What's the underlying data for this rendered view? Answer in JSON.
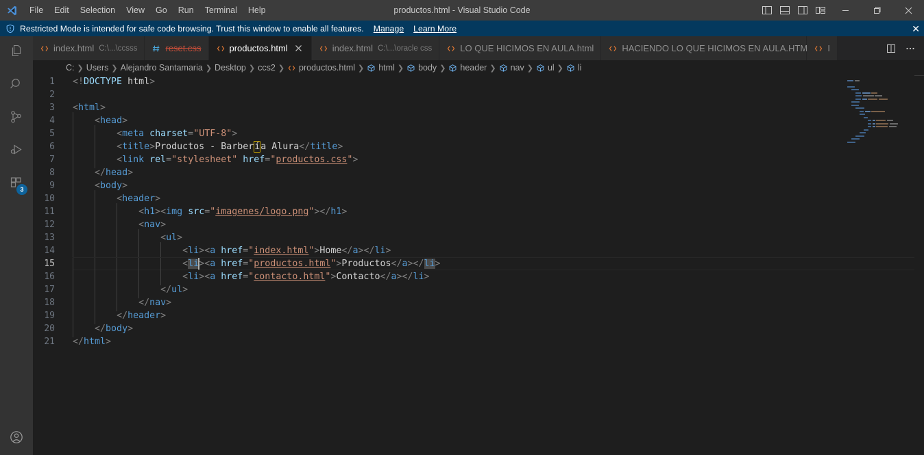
{
  "titlebar": {
    "logo_icon": "vscode-logo-icon",
    "menus": [
      "File",
      "Edit",
      "Selection",
      "View",
      "Go",
      "Run",
      "Terminal",
      "Help"
    ],
    "window_title": "productos.html - Visual Studio Code",
    "layout_buttons": [
      {
        "name": "toggle-primary-sidebar-button",
        "icon": "panel-left-icon"
      },
      {
        "name": "toggle-panel-button",
        "icon": "panel-bottom-icon"
      },
      {
        "name": "toggle-secondary-sidebar-button",
        "icon": "panel-right-icon"
      },
      {
        "name": "customize-layout-button",
        "icon": "layout-icon"
      }
    ],
    "window_controls": [
      {
        "name": "minimize-button",
        "label": "—"
      },
      {
        "name": "maximize-button",
        "label": "❐"
      },
      {
        "name": "close-button",
        "label": "✕"
      }
    ]
  },
  "banner": {
    "icon": "shield-icon",
    "text": "Restricted Mode is intended for safe code browsing. Trust this window to enable all features.",
    "links": [
      "Manage",
      "Learn More"
    ],
    "close_label": "✕",
    "background": "#04395e"
  },
  "activitybar": {
    "items": [
      {
        "name": "sidebar-item-explorer",
        "icon": "files-icon",
        "badge": null
      },
      {
        "name": "sidebar-item-search",
        "icon": "search-icon",
        "badge": null
      },
      {
        "name": "sidebar-item-source-control",
        "icon": "source-control-icon",
        "badge": null
      },
      {
        "name": "sidebar-item-run-debug",
        "icon": "run-debug-icon",
        "badge": null
      },
      {
        "name": "sidebar-item-extensions",
        "icon": "extensions-icon",
        "badge": "3"
      }
    ],
    "bottom_items": [
      {
        "name": "accounts-button",
        "icon": "account-icon"
      }
    ]
  },
  "tabs": [
    {
      "label": "index.html",
      "description": "C:\\...\\ccsss",
      "icon": "html-file-icon",
      "active": false,
      "deleted": false,
      "closable": false
    },
    {
      "label": "reset.css",
      "description": "",
      "icon": "css-file-icon",
      "active": false,
      "deleted": true,
      "closable": false
    },
    {
      "label": "productos.html",
      "description": "",
      "icon": "html-file-icon",
      "active": true,
      "deleted": false,
      "closable": true
    },
    {
      "label": "index.html",
      "description": "C:\\...\\oracle css",
      "icon": "html-file-icon",
      "active": false,
      "deleted": false,
      "closable": false
    },
    {
      "label": "LO QUE HICIMOS EN AULA.html",
      "description": "",
      "icon": "html-file-icon",
      "active": false,
      "deleted": false,
      "closable": false
    },
    {
      "label": "HACIENDO LO QUE HICIMOS EN AULA.HTML",
      "description": "",
      "icon": "html-file-icon",
      "active": false,
      "deleted": false,
      "closable": false
    },
    {
      "label": "I",
      "description": "",
      "icon": "html-file-icon",
      "active": false,
      "deleted": false,
      "closable": false
    }
  ],
  "tab_actions": [
    {
      "name": "split-editor-button",
      "icon": "split-editor-icon"
    },
    {
      "name": "more-actions-button",
      "icon": "ellipsis-icon"
    }
  ],
  "breadcrumbs": [
    {
      "label": "C:",
      "icon": null
    },
    {
      "label": "Users",
      "icon": null
    },
    {
      "label": "Alejandro Santamaria",
      "icon": null
    },
    {
      "label": "Desktop",
      "icon": null
    },
    {
      "label": "ccs2",
      "icon": null
    },
    {
      "label": "productos.html",
      "icon": "html-file-icon"
    },
    {
      "label": "html",
      "icon": "symbol-field-icon"
    },
    {
      "label": "body",
      "icon": "symbol-field-icon"
    },
    {
      "label": "header",
      "icon": "symbol-field-icon"
    },
    {
      "label": "nav",
      "icon": "symbol-field-icon"
    },
    {
      "label": "ul",
      "icon": "symbol-field-icon"
    },
    {
      "label": "li",
      "icon": "symbol-field-icon"
    }
  ],
  "editor": {
    "language": "html",
    "active_line": 15,
    "cursor_position": {
      "line": 15,
      "column": 29
    },
    "lines": [
      {
        "n": 1,
        "text": "<!DOCTYPE html>"
      },
      {
        "n": 2,
        "text": ""
      },
      {
        "n": 3,
        "text": "<html>"
      },
      {
        "n": 4,
        "text": "    <head>"
      },
      {
        "n": 5,
        "text": "        <meta charset=\"UTF-8\">"
      },
      {
        "n": 6,
        "text": "        <title>Productos - Barbería Alura</title>"
      },
      {
        "n": 7,
        "text": "        <link rel=\"stylesheet\" href=\"productos.css\">"
      },
      {
        "n": 8,
        "text": "    </head>"
      },
      {
        "n": 9,
        "text": "    <body>"
      },
      {
        "n": 10,
        "text": "        <header>"
      },
      {
        "n": 11,
        "text": "            <h1><img src=\"imagenes/logo.png\"></h1>"
      },
      {
        "n": 12,
        "text": "            <nav>"
      },
      {
        "n": 13,
        "text": "                <ul>"
      },
      {
        "n": 14,
        "text": "                    <li><a href=\"index.html\">Home</a></li>"
      },
      {
        "n": 15,
        "text": "                    <li><a href=\"productos.html\">Productos</a></li>"
      },
      {
        "n": 16,
        "text": "                    <li><a href=\"contacto.html\">Contacto</a></li>"
      },
      {
        "n": 17,
        "text": "                </ul>"
      },
      {
        "n": 18,
        "text": "            </nav>"
      },
      {
        "n": 19,
        "text": "        </header>"
      },
      {
        "n": 20,
        "text": "    </body>"
      },
      {
        "n": 21,
        "text": "</html>"
      }
    ]
  },
  "colors": {
    "editor_background": "#1e1e1e",
    "titlebar_background": "#3c3c3c",
    "activitybar_background": "#333333",
    "tabs_background": "#252526",
    "tag": "#569cd6",
    "attribute": "#9cdcfe",
    "string": "#ce9178",
    "text": "#d4d4d4",
    "bracket": "#808080",
    "line_number": "#6e7681",
    "badge": "#0e639c",
    "deleted_tab": "#c74e39",
    "unicode_highlight": "#cca700"
  }
}
